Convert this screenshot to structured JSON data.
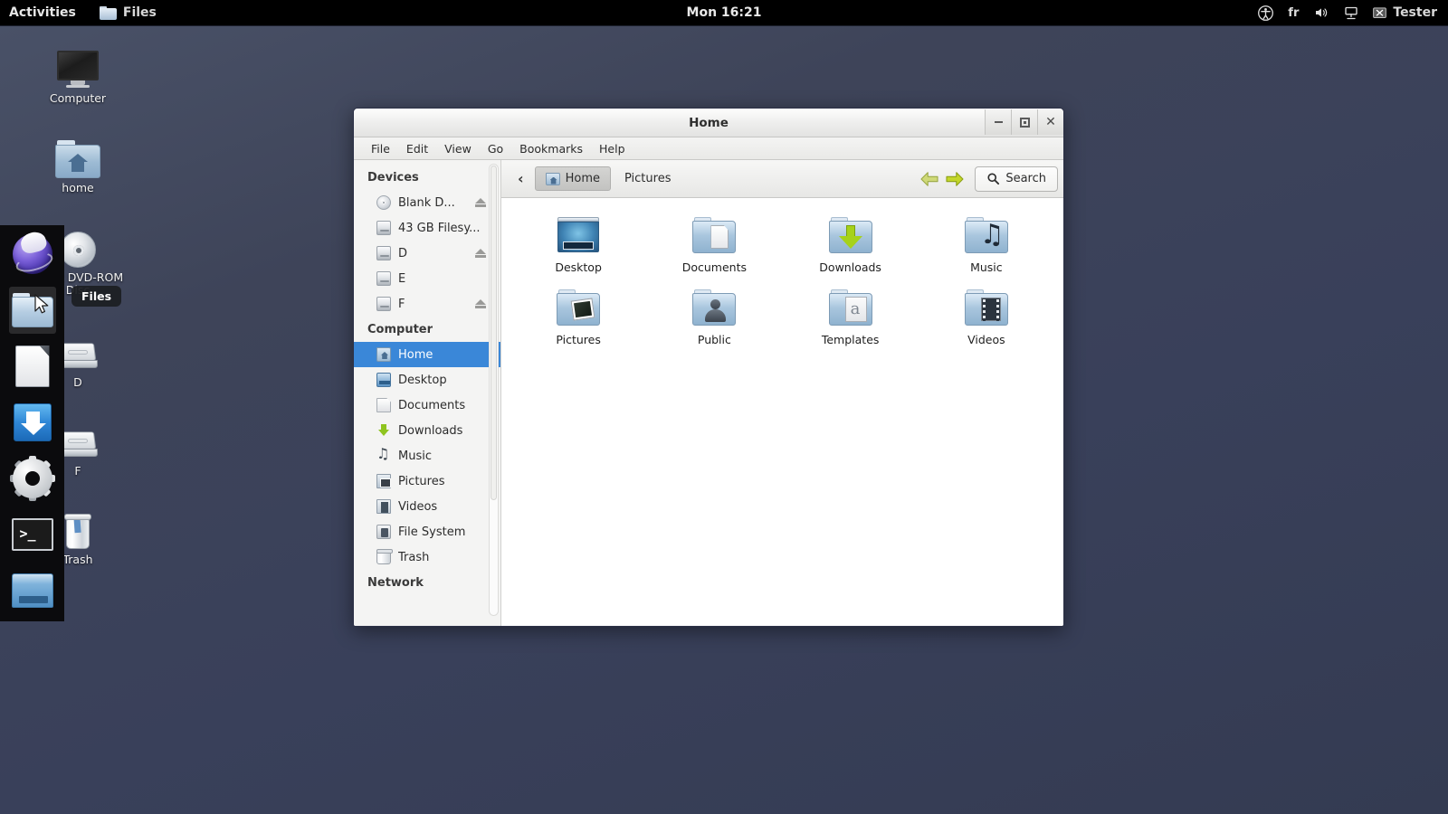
{
  "topbar": {
    "activities": "Activities",
    "app_name": "Files",
    "clock": "Mon 16:21",
    "keyboard_layout": "fr",
    "user": "Tester",
    "accessibility_icon": "accessibility-icon",
    "volume_icon": "volume-icon",
    "network_icon": "network-icon"
  },
  "desktop": {
    "icons": [
      {
        "label": "Computer",
        "icon": "computer-monitor-icon"
      },
      {
        "label": "home",
        "icon": "home-folder-icon"
      },
      {
        "label": "Blank DVD-ROM Disc",
        "icon": "optical-disc-icon"
      },
      {
        "label": "D",
        "icon": "drive-icon"
      },
      {
        "label": "F",
        "icon": "drive-icon"
      },
      {
        "label": "Trash",
        "icon": "trash-icon"
      }
    ]
  },
  "dock": {
    "tooltip": "Files",
    "items": [
      {
        "name": "web-browser",
        "icon": "globe-icon"
      },
      {
        "name": "files",
        "icon": "folder-icon"
      },
      {
        "name": "document-editor",
        "icon": "document-icon"
      },
      {
        "name": "download-manager",
        "icon": "download-icon"
      },
      {
        "name": "settings",
        "icon": "gear-icon"
      },
      {
        "name": "terminal",
        "icon": "terminal-icon"
      },
      {
        "name": "display",
        "icon": "screen-icon"
      }
    ]
  },
  "file_manager": {
    "title": "Home",
    "window_buttons": {
      "minimize": "minimize-icon",
      "maximize": "maximize-icon",
      "close": "close-icon"
    },
    "menus": [
      "File",
      "Edit",
      "View",
      "Go",
      "Bookmarks",
      "Help"
    ],
    "sidebar": {
      "sections": [
        {
          "heading": "Devices",
          "items": [
            {
              "label": "Blank D...",
              "icon": "optical-disc-icon",
              "eject": true,
              "selected": false
            },
            {
              "label": "43 GB Filesy...",
              "icon": "harddisk-icon",
              "eject": false,
              "selected": false
            },
            {
              "label": "D",
              "icon": "harddisk-icon",
              "eject": true,
              "selected": false
            },
            {
              "label": "E",
              "icon": "harddisk-icon",
              "eject": false,
              "selected": false
            },
            {
              "label": "F",
              "icon": "harddisk-icon",
              "eject": true,
              "selected": false
            }
          ]
        },
        {
          "heading": "Computer",
          "items": [
            {
              "label": "Home",
              "icon": "home-icon",
              "eject": false,
              "selected": true
            },
            {
              "label": "Desktop",
              "icon": "desktop-icon",
              "eject": false,
              "selected": false
            },
            {
              "label": "Documents",
              "icon": "documents-icon",
              "eject": false,
              "selected": false
            },
            {
              "label": "Downloads",
              "icon": "downloads-icon",
              "eject": false,
              "selected": false
            },
            {
              "label": "Music",
              "icon": "music-icon",
              "eject": false,
              "selected": false
            },
            {
              "label": "Pictures",
              "icon": "pictures-icon",
              "eject": false,
              "selected": false
            },
            {
              "label": "Videos",
              "icon": "videos-icon",
              "eject": false,
              "selected": false
            },
            {
              "label": "File System",
              "icon": "filesystem-icon",
              "eject": false,
              "selected": false
            },
            {
              "label": "Trash",
              "icon": "trash-icon",
              "eject": false,
              "selected": false
            }
          ]
        },
        {
          "heading": "Network",
          "items": []
        }
      ]
    },
    "toolbar": {
      "back_chevron": "chevron-left-icon",
      "breadcrumbs": [
        {
          "label": "Home",
          "active": true,
          "icon": "home-icon"
        },
        {
          "label": "Pictures",
          "active": false,
          "icon": ""
        }
      ],
      "back_label": "back-arrow-icon",
      "forward_label": "forward-arrow-icon",
      "search_label": "Search",
      "search_icon": "search-icon"
    },
    "files": [
      {
        "name": "Desktop",
        "icon": "desktop-preview-icon"
      },
      {
        "name": "Documents",
        "icon": "folder-documents-icon"
      },
      {
        "name": "Downloads",
        "icon": "folder-downloads-icon"
      },
      {
        "name": "Music",
        "icon": "folder-music-icon"
      },
      {
        "name": "Pictures",
        "icon": "folder-pictures-icon"
      },
      {
        "name": "Public",
        "icon": "folder-public-icon"
      },
      {
        "name": "Templates",
        "icon": "folder-templates-icon"
      },
      {
        "name": "Videos",
        "icon": "folder-videos-icon"
      }
    ]
  },
  "colors": {
    "selection_blue": "#3a87d8",
    "topbar_black": "#000000",
    "desktop_bg": "#3e4459"
  }
}
